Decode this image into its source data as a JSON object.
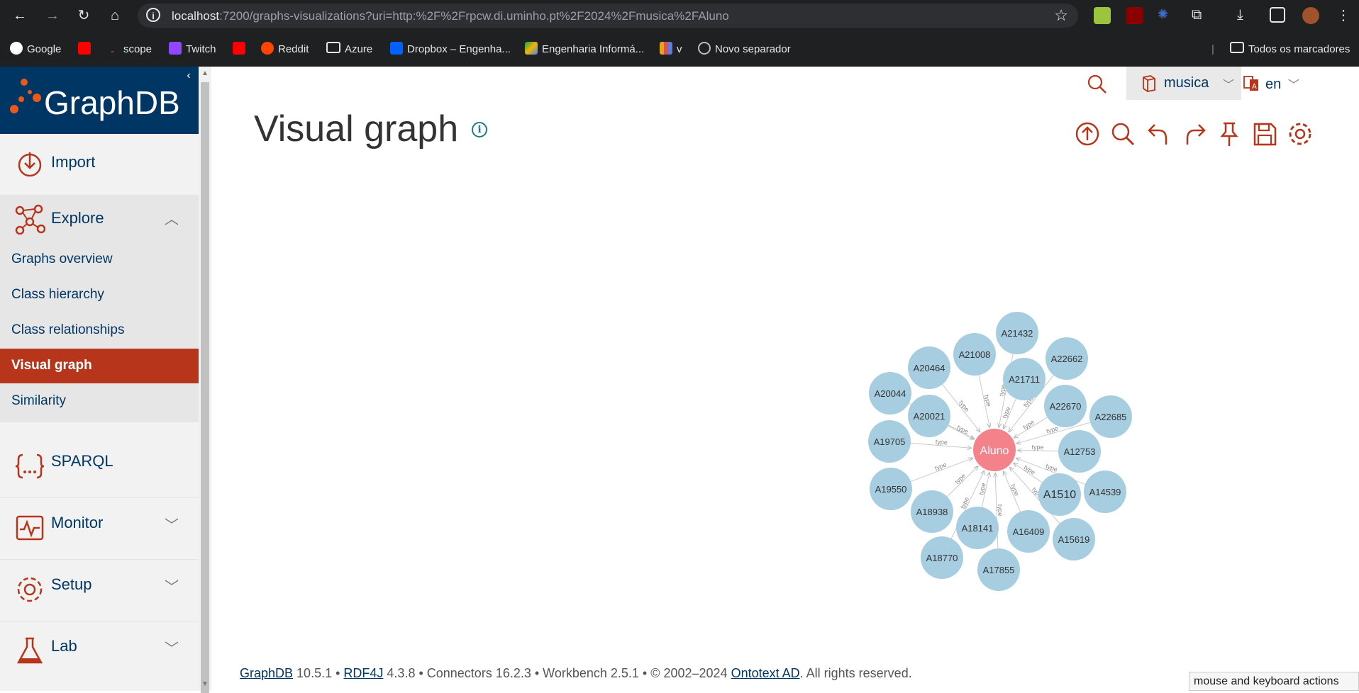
{
  "browser": {
    "url_host": "localhost",
    "url_rest": ":7200/graphs-visualizations?uri=http:%2F%2Frpcw.di.uminho.pt%2F2024%2Fmusica%2FAluno",
    "bookmarks": [
      "Google",
      "scope",
      "Twitch",
      "Reddit",
      "Azure",
      "Dropbox – Engenha...",
      "Engenharia Informá...",
      "v",
      "Novo separador"
    ],
    "all_bookmarks": "Todos os marcadores"
  },
  "sidebar": {
    "logo": "GraphDB",
    "items": [
      {
        "label": "Import",
        "icon": "import-icon"
      },
      {
        "label": "Explore",
        "icon": "explore-icon"
      },
      {
        "label": "SPARQL",
        "icon": "sparql-icon"
      },
      {
        "label": "Monitor",
        "icon": "monitor-icon"
      },
      {
        "label": "Setup",
        "icon": "setup-icon"
      },
      {
        "label": "Lab",
        "icon": "lab-icon"
      }
    ],
    "explore_sub": [
      "Graphs overview",
      "Class hierarchy",
      "Class relationships",
      "Visual graph",
      "Similarity"
    ],
    "active_sub": "Visual graph"
  },
  "header": {
    "repository": "musica",
    "language": "en"
  },
  "main": {
    "title": "Visual graph",
    "toolbar": [
      "export-icon",
      "search-icon",
      "undo-icon",
      "redo-icon",
      "pin-icon",
      "save-icon",
      "settings-icon"
    ]
  },
  "graph": {
    "center": "Aluno",
    "edge_label": "type",
    "nodes": [
      "A21432",
      "A21008",
      "A22662",
      "A20464",
      "A21711",
      "A20044",
      "A22670",
      "A22685",
      "A20021",
      "A19705",
      "A12753",
      "A19550",
      "A14539",
      "A1510",
      "A18938",
      "A18141",
      "A16409",
      "A15619",
      "A18770",
      "A17855"
    ],
    "center_color": "#f4828a",
    "node_color": "#a7cde0"
  },
  "footer": {
    "graphdb": "GraphDB",
    "graphdb_ver": " 10.5.1 • ",
    "rdf4j": "RDF4J",
    "rest": " 4.3.8 • Connectors 16.2.3 • Workbench 2.5.1 • © 2002–2024 ",
    "ontotext": "Ontotext AD",
    "end": ". All rights reserved."
  },
  "tooltip": "mouse and keyboard actions"
}
